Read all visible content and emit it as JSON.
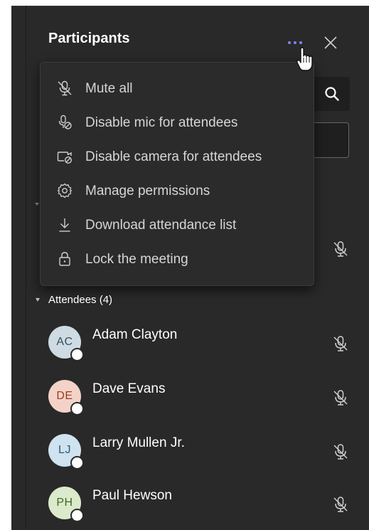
{
  "panel": {
    "title": "Participants",
    "more_label": "More options",
    "close_label": "Close"
  },
  "menu": {
    "items": [
      {
        "label": "Mute all",
        "icon": "mic-off-icon"
      },
      {
        "label": "Disable mic for attendees",
        "icon": "mic-prohibited-icon"
      },
      {
        "label": "Disable camera for attendees",
        "icon": "camera-prohibited-icon"
      },
      {
        "label": "Manage permissions",
        "icon": "gear-icon"
      },
      {
        "label": "Download attendance list",
        "icon": "download-icon"
      },
      {
        "label": "Lock the meeting",
        "icon": "lock-icon"
      }
    ]
  },
  "attendees": {
    "header": "Attendees (4)",
    "people": [
      {
        "initials": "AC",
        "name": "Adam Clayton",
        "avatar_bg": "#cfdbe3",
        "avatar_fg": "#33505f"
      },
      {
        "initials": "DE",
        "name": "Dave Evans",
        "avatar_bg": "#f3d3c8",
        "avatar_fg": "#9c3b1f"
      },
      {
        "initials": "LJ",
        "name": "Larry Mullen Jr.",
        "avatar_bg": "#cfe2ef",
        "avatar_fg": "#2a5b7a"
      },
      {
        "initials": "PH",
        "name": "Paul Hewson",
        "avatar_bg": "#dbeacb",
        "avatar_fg": "#3f6a22"
      }
    ]
  },
  "colors": {
    "panel_bg": "#292929",
    "accent": "#7f85f5"
  }
}
